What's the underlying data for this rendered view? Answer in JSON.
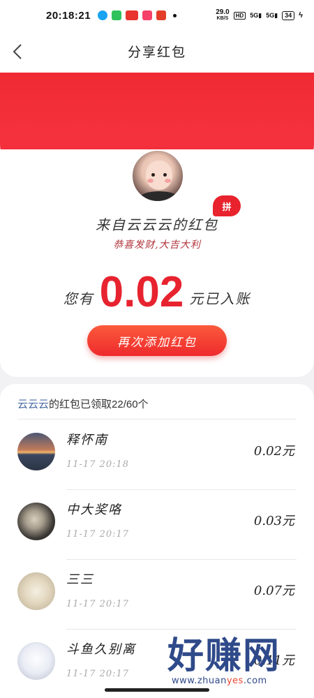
{
  "status_bar": {
    "time": "20:18:21",
    "net_speed_value": "29.0",
    "net_speed_unit": "KB/S",
    "hd": "HD",
    "signal_1": "5G",
    "signal_2": "5G",
    "battery": "34"
  },
  "header": {
    "title": "分享红包"
  },
  "packet": {
    "badge": "拼",
    "sender_line": "来自云云云的红包",
    "blessing": "恭喜发财,大吉大利",
    "amount_prefix": "您有",
    "amount": "0.02",
    "amount_suffix": "元已入账",
    "add_button_label": "再次添加红包"
  },
  "list": {
    "owner": "云云云",
    "summary_rest": "的红包已领取22/60个",
    "items": [
      {
        "name": "释怀南",
        "time": "11-17 20:18",
        "amount": "0.02元"
      },
      {
        "name": "中大奖咯",
        "time": "11-17 20:17",
        "amount": "0.03元"
      },
      {
        "name": "三三",
        "time": "11-17 20:17",
        "amount": "0.07元"
      },
      {
        "name": "斗鱼久别离",
        "time": "11-17 20:17",
        "amount": "0.11元"
      }
    ]
  },
  "watermark": {
    "text": "好赚网",
    "url_pre": "www.zhuan",
    "url_hl": "yes",
    "url_post": ".com"
  }
}
